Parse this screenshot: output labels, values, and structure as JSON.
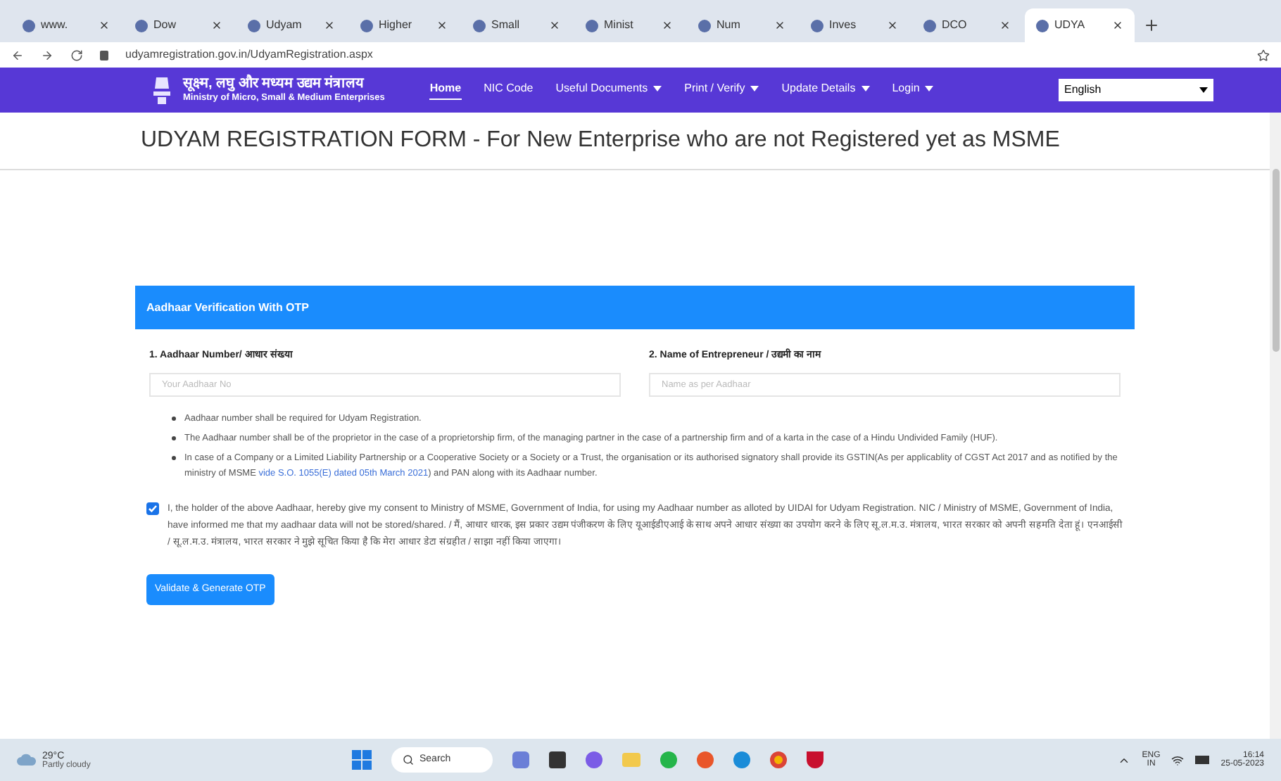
{
  "browser": {
    "tabs": [
      {
        "label": "www.",
        "selected": false
      },
      {
        "label": "Dow",
        "selected": false
      },
      {
        "label": "Udyam",
        "selected": false
      },
      {
        "label": "Higher",
        "selected": false
      },
      {
        "label": "Small",
        "selected": false
      },
      {
        "label": "Minist",
        "selected": false
      },
      {
        "label": "Num",
        "selected": false
      },
      {
        "label": "Inves",
        "selected": false
      },
      {
        "label": "DCO",
        "selected": false
      },
      {
        "label": "UDYA",
        "selected": true
      }
    ],
    "address": "udyamregistration.gov.in/UdyamRegistration.aspx"
  },
  "header": {
    "logo_hindi": "सूक्ष्म, लघु और मध्यम उद्यम मंत्रालय",
    "logo_english": "Ministry of Micro, Small & Medium Enterprises",
    "nav": [
      {
        "label": "Home",
        "selected": true,
        "dropdown": false
      },
      {
        "label": "NIC Code",
        "selected": false,
        "dropdown": false
      },
      {
        "label": "Useful Documents",
        "selected": false,
        "dropdown": true
      },
      {
        "label": "Print / Verify",
        "selected": false,
        "dropdown": true
      },
      {
        "label": "Update Details",
        "selected": false,
        "dropdown": true
      },
      {
        "label": "Login",
        "selected": false,
        "dropdown": true
      }
    ],
    "language": "English"
  },
  "page_title": "UDYAM REGISTRATION FORM - For New Enterprise who are not Registered yet as MSME",
  "card": {
    "title": "Aadhaar Verification With OTP",
    "fields": [
      {
        "label": "1. Aadhaar Number/ आधार संख्या",
        "placeholder": "Your Aadhaar No"
      },
      {
        "label": "2. Name of Entrepreneur / उद्यमी का नाम",
        "placeholder": "Name as per Aadhaar"
      }
    ],
    "notes": [
      {
        "text": "Aadhaar number shall be required for Udyam Registration."
      },
      {
        "text": "The Aadhaar number shall be of the proprietor in the case of a proprietorship firm, of the managing partner in the case of a partnership firm and of a karta in the case of a Hindu Undivided Family (HUF)."
      },
      {
        "text": "In case of a Company or a Limited Liability Partnership or a Cooperative Society or a Society or a Trust, the organisation or its authorised signatory shall provide its GSTIN(As per applicablity of CGST Act 2017 and as notified by the ministry of MSME ",
        "link": "vide S.O. 1055(E) dated 05th March 2021",
        "after": ") and PAN along with its Aadhaar number."
      }
    ],
    "consent": {
      "checked": true,
      "text": "I, the holder of the above Aadhaar, hereby give my consent to Ministry of MSME, Government of India, for using my Aadhaar number as alloted by UIDAI for Udyam Registration. NIC / Ministry of MSME, Government of India, have informed me that my aadhaar data will not be stored/shared. / मैं, आधार धारक, इस प्रकार उद्यम पंजीकरण के लिए यूआईडीएआई के साथ अपने आधार संख्या का उपयोग करने के लिए सू.ल.म.उ. मंत्रालय, भारत सरकार को अपनी सहमति देता हूं। एनआईसी / सू.ल.म.उ. मंत्रालय, भारत सरकार ने मुझे सूचित किया है कि मेरा आधार डेटा संग्रहीत / साझा नहीं किया जाएगा।"
    },
    "button": "Validate & Generate OTP"
  },
  "taskbar": {
    "weather_temp": "29°C",
    "weather_text": "Partly cloudy",
    "search": "Search",
    "lang_top": "ENG",
    "lang_bottom": "IN",
    "time": "16:14",
    "date": "25-05-2023"
  }
}
